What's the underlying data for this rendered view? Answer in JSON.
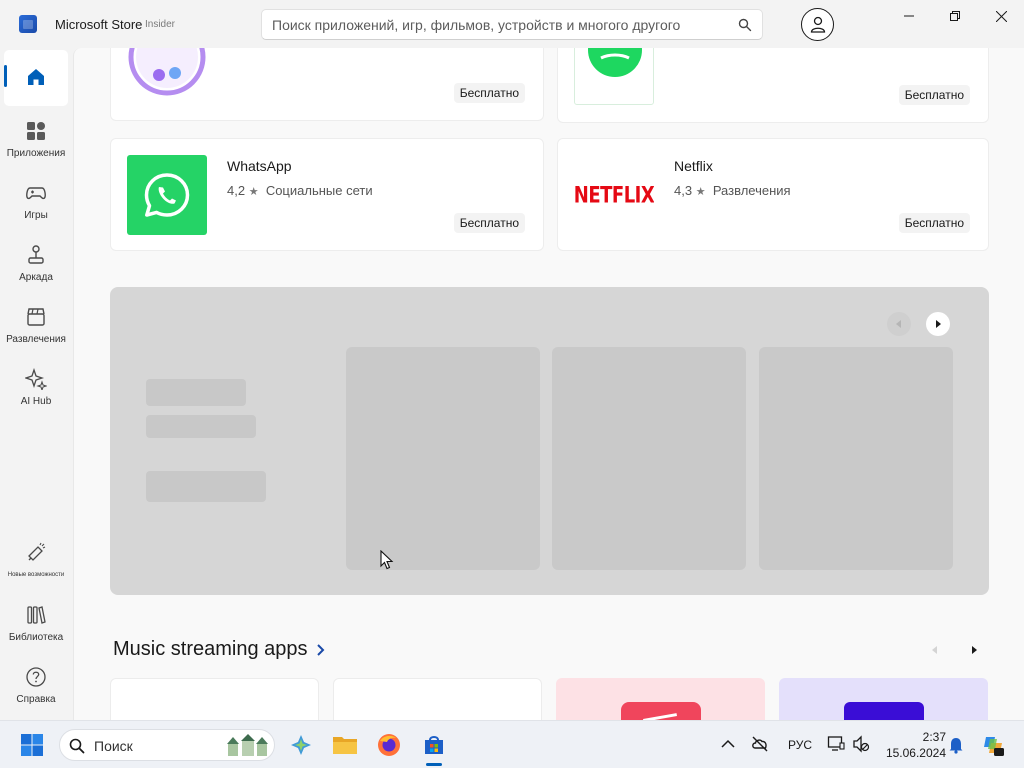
{
  "window": {
    "title": "Microsoft Store",
    "badge": "Insider"
  },
  "search": {
    "placeholder": "Поиск приложений, игр, фильмов, устройств и многого другого"
  },
  "nav": {
    "items": [
      {
        "label": ""
      },
      {
        "label": "Приложения"
      },
      {
        "label": "Игры"
      },
      {
        "label": "Аркада"
      },
      {
        "label": "Развлечения"
      },
      {
        "label": "AI Hub"
      },
      {
        "label": "Новые возможности"
      },
      {
        "label": "Библиотека"
      },
      {
        "label": "Справка"
      }
    ]
  },
  "cards_top": [
    {
      "price": "Бесплатно"
    },
    {
      "price": "Бесплатно"
    }
  ],
  "cards": [
    {
      "name": "WhatsApp",
      "rating": "4,2",
      "category": "Социальные сети",
      "price": "Бесплатно",
      "logo_color": "#25d366"
    },
    {
      "name": "Netflix",
      "rating": "4,3",
      "category": "Развлечения",
      "price": "Бесплатно",
      "logo_text": "NETFLIX",
      "logo_color": "#e50914"
    }
  ],
  "section": {
    "title": "Music streaming apps"
  },
  "taskbar": {
    "search_label": "Поиск",
    "language": "РУС",
    "time": "2:37",
    "date": "15.06.2024"
  },
  "colors": {
    "accent": "#005fb8"
  }
}
